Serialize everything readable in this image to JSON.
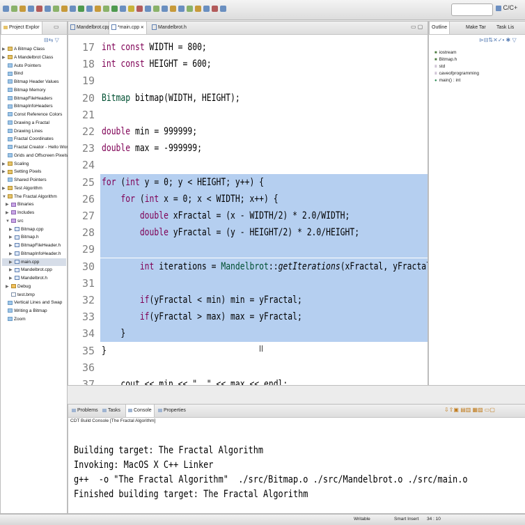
{
  "toolbar": {
    "search_placeholder": "",
    "perspective_label": "C/C+"
  },
  "project_explorer": {
    "tab_label": "Project Explor",
    "items": [
      {
        "label": "A Bitmap Class",
        "indent": 0,
        "fold": "▶",
        "icon": "proj"
      },
      {
        "label": "A Mandelbrot Class",
        "indent": 0,
        "fold": "▶",
        "icon": "proj"
      },
      {
        "label": "Auto Pointers",
        "indent": 0,
        "fold": "",
        "icon": "folder"
      },
      {
        "label": "Bind",
        "indent": 0,
        "fold": "",
        "icon": "folder"
      },
      {
        "label": "Bitmap Header Values",
        "indent": 0,
        "fold": "",
        "icon": "folder"
      },
      {
        "label": "Bitmap Memory",
        "indent": 0,
        "fold": "",
        "icon": "folder"
      },
      {
        "label": "BitmapFileHeaders",
        "indent": 0,
        "fold": "",
        "icon": "folder"
      },
      {
        "label": "BitmapInfoHeaders",
        "indent": 0,
        "fold": "",
        "icon": "folder"
      },
      {
        "label": "Const Reference Colors",
        "indent": 0,
        "fold": "",
        "icon": "folder"
      },
      {
        "label": "Drawing a Fractal",
        "indent": 0,
        "fold": "",
        "icon": "folder"
      },
      {
        "label": "Drawing Lines",
        "indent": 0,
        "fold": "",
        "icon": "folder"
      },
      {
        "label": "Fractal Coordinates",
        "indent": 0,
        "fold": "",
        "icon": "folder"
      },
      {
        "label": "Fractal Creator - Hello Worl",
        "indent": 0,
        "fold": "",
        "icon": "folder"
      },
      {
        "label": "Grids and Offscreen Pixels",
        "indent": 0,
        "fold": "",
        "icon": "folder"
      },
      {
        "label": "Scaling",
        "indent": 0,
        "fold": "▶",
        "icon": "proj"
      },
      {
        "label": "Setting Pixels",
        "indent": 0,
        "fold": "▶",
        "icon": "proj"
      },
      {
        "label": "Shared Pointers",
        "indent": 0,
        "fold": "",
        "icon": "folder"
      },
      {
        "label": "Test Algorithm",
        "indent": 0,
        "fold": "▶",
        "icon": "proj"
      },
      {
        "label": "The Fractal Algorithm",
        "indent": 0,
        "fold": "▼",
        "icon": "proj"
      },
      {
        "label": "Binaries",
        "indent": 1,
        "fold": "▶",
        "icon": "pkg"
      },
      {
        "label": "Includes",
        "indent": 1,
        "fold": "▶",
        "icon": "pkg"
      },
      {
        "label": "src",
        "indent": 1,
        "fold": "▼",
        "icon": "pkg"
      },
      {
        "label": "Bitmap.cpp",
        "indent": 2,
        "fold": "▶",
        "icon": "cfile"
      },
      {
        "label": "Bitmap.h",
        "indent": 2,
        "fold": "▶",
        "icon": "cfile"
      },
      {
        "label": "BitmapFileHeader.h",
        "indent": 2,
        "fold": "▶",
        "icon": "cfile"
      },
      {
        "label": "BitmapInfoHeader.h",
        "indent": 2,
        "fold": "▶",
        "icon": "cfile"
      },
      {
        "label": "main.cpp",
        "indent": 2,
        "fold": "▶",
        "icon": "cfile",
        "selected": true
      },
      {
        "label": "Mandelbrot.cpp",
        "indent": 2,
        "fold": "▶",
        "icon": "cfile"
      },
      {
        "label": "Mandelbrot.h",
        "indent": 2,
        "fold": "▶",
        "icon": "cfile"
      },
      {
        "label": "Debug",
        "indent": 1,
        "fold": "▶",
        "icon": "debug"
      },
      {
        "label": "test.bmp",
        "indent": 1,
        "fold": "",
        "icon": "file"
      },
      {
        "label": "Vertical Lines and Swap",
        "indent": 0,
        "fold": "",
        "icon": "folder"
      },
      {
        "label": "Writing a Bitmap",
        "indent": 0,
        "fold": "",
        "icon": "folder"
      },
      {
        "label": "Zoom",
        "indent": 0,
        "fold": "",
        "icon": "folder"
      }
    ]
  },
  "editor": {
    "tabs": [
      "Mandelbrot.cpp",
      "*main.cpp",
      "Mandelbrot.h"
    ],
    "active_tab": 1,
    "lines": [
      {
        "n": "17",
        "hl": false,
        "html": "<span class='kw'>int</span> <span class='kw'>const</span> WIDTH = 800;"
      },
      {
        "n": "18",
        "hl": false,
        "html": "<span class='kw'>int</span> <span class='kw'>const</span> HEIGHT = 600;"
      },
      {
        "n": "19",
        "hl": false,
        "html": ""
      },
      {
        "n": "20",
        "hl": false,
        "html": "<span class='type'>Bitmap</span> bitmap(WIDTH, HEIGHT);"
      },
      {
        "n": "21",
        "hl": false,
        "html": ""
      },
      {
        "n": "22",
        "hl": false,
        "html": "<span class='kw'>double</span> min = 999999;"
      },
      {
        "n": "23",
        "hl": false,
        "html": "<span class='kw'>double</span> max = -999999;"
      },
      {
        "n": "24",
        "hl": false,
        "html": ""
      },
      {
        "n": "25",
        "hl": true,
        "html": "<span class='kw'>for</span> (<span class='kw'>int</span> y = 0; y &lt; HEIGHT; y++) {"
      },
      {
        "n": "26",
        "hl": true,
        "html": "    <span class='kw'>for</span> (<span class='kw'>int</span> x = 0; x &lt; WIDTH; x++) {"
      },
      {
        "n": "27",
        "hl": true,
        "html": "        <span class='kw'>double</span> xFractal = (x - WIDTH/2) * 2.0/WIDTH;"
      },
      {
        "n": "28",
        "hl": true,
        "html": "        <span class='kw'>double</span> yFractal = (y - HEIGHT/2) * 2.0/HEIGHT;"
      },
      {
        "n": "29",
        "hl": true,
        "html": ""
      },
      {
        "n": "30",
        "hl": true,
        "html": "        <span class='kw'>int</span> iterations = <span class='type'>Mandelbrot</span>::<span class='fn'>getIterations</span>(xFractal, yFractal);"
      },
      {
        "n": "31",
        "hl": true,
        "html": ""
      },
      {
        "n": "32",
        "hl": true,
        "html": "        <span class='kw'>if</span>(yFractal &lt; min) min = yFractal;"
      },
      {
        "n": "33",
        "hl": true,
        "html": "        <span class='kw'>if</span>(yFractal &gt; max) max = yFractal;"
      },
      {
        "n": "34",
        "hl": true,
        "html": "    }"
      },
      {
        "n": "35",
        "hl": false,
        "html": "}"
      },
      {
        "n": "36",
        "hl": false,
        "html": ""
      },
      {
        "n": "37",
        "hl": false,
        "html": "    cout &lt;&lt; min &lt;&lt; \", \" &lt;&lt; max &lt;&lt; endl;"
      }
    ]
  },
  "outline": {
    "tabs": [
      "Outline",
      "Make Tar",
      "Task Lis"
    ],
    "items": [
      {
        "label": "iostream",
        "color": "#4a7a3d",
        "glyph": "■"
      },
      {
        "label": "Bitmap.h",
        "color": "#4a7a3d",
        "glyph": "■"
      },
      {
        "label": "std",
        "color": "#7a5a8c",
        "glyph": "≡"
      },
      {
        "label": "caveofprogramming",
        "color": "#7a5a8c",
        "glyph": "≡"
      },
      {
        "label": "main() : int",
        "color": "#2e8b57",
        "glyph": "●"
      }
    ]
  },
  "console": {
    "tabs": [
      "Problems",
      "Tasks",
      "Console",
      "Properties"
    ],
    "header": "CDT Build Console [The Fractal Algorithm]",
    "lines": [
      "Building target: The Fractal Algorithm",
      "Invoking: MacOS X C++ Linker",
      "g++  -o \"The Fractal Algorithm\"  ./src/Bitmap.o ./src/Mandelbrot.o ./src/main.o",
      "Finished building target: The Fractal Algorithm"
    ]
  },
  "status": {
    "writable": "Writable",
    "insert_mode": "Smart Insert",
    "position": "34 : 10"
  }
}
